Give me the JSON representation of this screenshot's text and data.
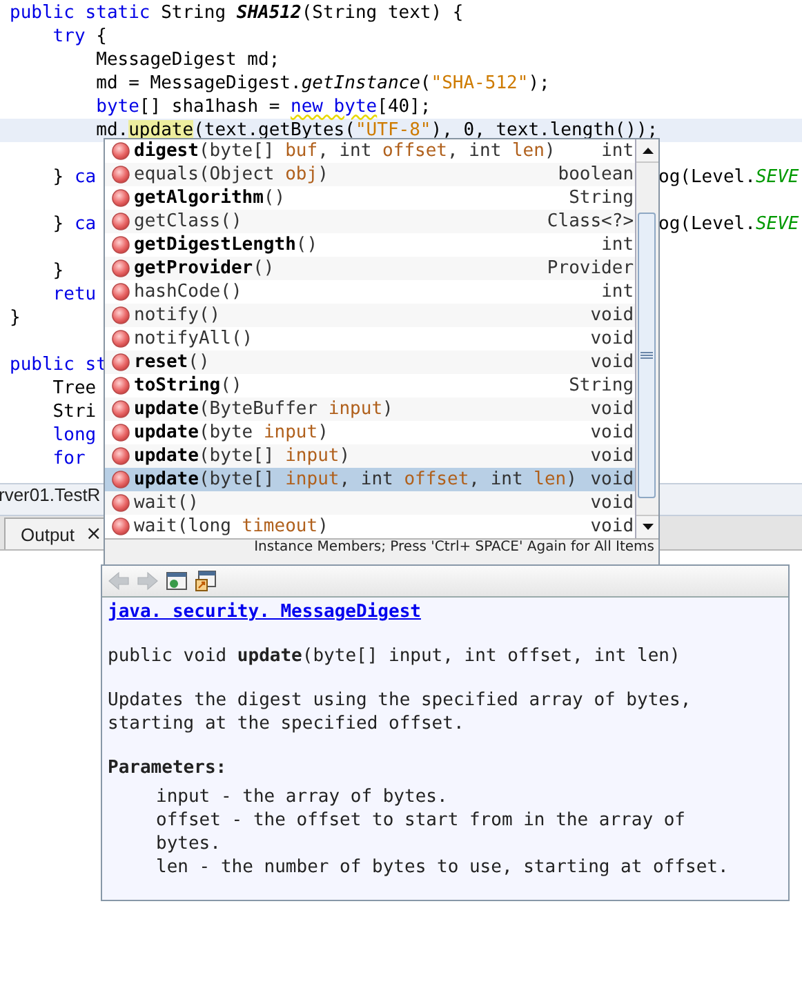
{
  "editor": {
    "lines": [
      {
        "current": false,
        "segments": [
          {
            "text": "public static ",
            "kind": "keyword"
          },
          {
            "text": "String ",
            "kind": "plain"
          },
          {
            "text": "SHA512",
            "kind": "method-bold-italic"
          },
          {
            "text": "(String text) {",
            "kind": "plain"
          }
        ]
      },
      {
        "current": false,
        "segments": [
          {
            "text": "    try",
            "kind": "keyword"
          },
          {
            "text": " {",
            "kind": "plain"
          }
        ]
      },
      {
        "current": false,
        "segments": [
          {
            "text": "        MessageDigest md;",
            "kind": "plain"
          }
        ]
      },
      {
        "current": false,
        "segments": [
          {
            "text": "        md = MessageDigest.",
            "kind": "plain"
          },
          {
            "text": "getInstance",
            "kind": "method-italic"
          },
          {
            "text": "(",
            "kind": "plain"
          },
          {
            "text": "\"SHA-512\"",
            "kind": "string"
          },
          {
            "text": ");",
            "kind": "plain"
          }
        ]
      },
      {
        "current": false,
        "segments": [
          {
            "text": "        byte",
            "kind": "keyword"
          },
          {
            "text": "[] sha1hash = ",
            "kind": "plain"
          },
          {
            "text": "new byte",
            "kind": "keyword-warning"
          },
          {
            "text": "[40];",
            "kind": "plain"
          }
        ]
      },
      {
        "current": true,
        "segments": [
          {
            "text": "        md.",
            "kind": "plain"
          },
          {
            "text": "update",
            "kind": "occurrence"
          },
          {
            "text": "(text.getBytes(",
            "kind": "plain"
          },
          {
            "text": "\"UTF-8\"",
            "kind": "string"
          },
          {
            "text": "), 0, text.length());",
            "kind": "plain"
          }
        ]
      },
      {
        "current": false
      },
      {
        "current": false,
        "segments": [
          {
            "text": "    } ",
            "kind": "plain"
          },
          {
            "text": "ca",
            "kind": "keyword"
          }
        ],
        "right": [
          {
            "text": "og(Level.",
            "kind": "plain"
          },
          {
            "text": "SEVE",
            "kind": "constant"
          }
        ]
      },
      {
        "current": false
      },
      {
        "current": false,
        "segments": [
          {
            "text": "    } ",
            "kind": "plain"
          },
          {
            "text": "ca",
            "kind": "keyword"
          }
        ],
        "right": [
          {
            "text": "og(Level.",
            "kind": "plain"
          },
          {
            "text": "SEVE",
            "kind": "constant"
          }
        ]
      },
      {
        "current": false
      },
      {
        "current": false,
        "segments": [
          {
            "text": "    }",
            "kind": "plain"
          }
        ]
      },
      {
        "current": false,
        "segments": [
          {
            "text": "    retu",
            "kind": "keyword"
          }
        ]
      },
      {
        "current": false,
        "segments": [
          {
            "text": "}",
            "kind": "plain"
          }
        ]
      },
      {
        "current": false
      },
      {
        "current": false,
        "segments": [
          {
            "text": "public st",
            "kind": "keyword"
          }
        ]
      },
      {
        "current": false,
        "segments": [
          {
            "text": "    Tree",
            "kind": "plain"
          }
        ]
      },
      {
        "current": false,
        "segments": [
          {
            "text": "    Stri",
            "kind": "plain"
          }
        ]
      },
      {
        "current": false,
        "segments": [
          {
            "text": "    long",
            "kind": "keyword"
          }
        ]
      },
      {
        "current": false,
        "segments": [
          {
            "text": "    for",
            "kind": "keyword"
          }
        ]
      }
    ]
  },
  "breadcrumb": "rver01.TestR",
  "output_tab": {
    "label": "Output",
    "close": "×"
  },
  "completion": {
    "items": [
      {
        "selected": false,
        "type": "int",
        "segments": [
          {
            "text": "digest",
            "kind": "name-bold"
          },
          {
            "text": "(byte[] ",
            "kind": "plain"
          },
          {
            "text": "buf",
            "kind": "param"
          },
          {
            "text": ", int ",
            "kind": "plain"
          },
          {
            "text": "offset",
            "kind": "param"
          },
          {
            "text": ", int ",
            "kind": "plain"
          },
          {
            "text": "len",
            "kind": "param"
          },
          {
            "text": ")",
            "kind": "plain"
          }
        ]
      },
      {
        "selected": false,
        "type": "boolean",
        "segments": [
          {
            "text": "equals",
            "kind": "name"
          },
          {
            "text": "(Object ",
            "kind": "plain"
          },
          {
            "text": "obj",
            "kind": "param"
          },
          {
            "text": ")",
            "kind": "plain"
          }
        ]
      },
      {
        "selected": false,
        "type": "String",
        "segments": [
          {
            "text": "getAlgorithm",
            "kind": "name-bold"
          },
          {
            "text": "()",
            "kind": "plain"
          }
        ]
      },
      {
        "selected": false,
        "type": "Class<?>",
        "segments": [
          {
            "text": "getClass",
            "kind": "name"
          },
          {
            "text": "()",
            "kind": "plain"
          }
        ]
      },
      {
        "selected": false,
        "type": "int",
        "segments": [
          {
            "text": "getDigestLength",
            "kind": "name-bold"
          },
          {
            "text": "()",
            "kind": "plain"
          }
        ]
      },
      {
        "selected": false,
        "type": "Provider",
        "segments": [
          {
            "text": "getProvider",
            "kind": "name-bold"
          },
          {
            "text": "()",
            "kind": "plain"
          }
        ]
      },
      {
        "selected": false,
        "type": "int",
        "segments": [
          {
            "text": "hashCode",
            "kind": "name"
          },
          {
            "text": "()",
            "kind": "plain"
          }
        ]
      },
      {
        "selected": false,
        "type": "void",
        "segments": [
          {
            "text": "notify",
            "kind": "name"
          },
          {
            "text": "()",
            "kind": "plain"
          }
        ]
      },
      {
        "selected": false,
        "type": "void",
        "segments": [
          {
            "text": "notifyAll",
            "kind": "name"
          },
          {
            "text": "()",
            "kind": "plain"
          }
        ]
      },
      {
        "selected": false,
        "type": "void",
        "segments": [
          {
            "text": "reset",
            "kind": "name-bold"
          },
          {
            "text": "()",
            "kind": "plain"
          }
        ]
      },
      {
        "selected": false,
        "type": "String",
        "segments": [
          {
            "text": "toString",
            "kind": "name-bold"
          },
          {
            "text": "()",
            "kind": "plain"
          }
        ]
      },
      {
        "selected": false,
        "type": "void",
        "segments": [
          {
            "text": "update",
            "kind": "name-bold"
          },
          {
            "text": "(ByteBuffer ",
            "kind": "plain"
          },
          {
            "text": "input",
            "kind": "param"
          },
          {
            "text": ")",
            "kind": "plain"
          }
        ]
      },
      {
        "selected": false,
        "type": "void",
        "segments": [
          {
            "text": "update",
            "kind": "name-bold"
          },
          {
            "text": "(byte ",
            "kind": "plain"
          },
          {
            "text": "input",
            "kind": "param"
          },
          {
            "text": ")",
            "kind": "plain"
          }
        ]
      },
      {
        "selected": false,
        "type": "void",
        "segments": [
          {
            "text": "update",
            "kind": "name-bold"
          },
          {
            "text": "(byte[] ",
            "kind": "plain"
          },
          {
            "text": "input",
            "kind": "param"
          },
          {
            "text": ")",
            "kind": "plain"
          }
        ]
      },
      {
        "selected": true,
        "type": "void",
        "segments": [
          {
            "text": "update",
            "kind": "name-bold"
          },
          {
            "text": "(byte[] ",
            "kind": "plain"
          },
          {
            "text": "input",
            "kind": "param"
          },
          {
            "text": ", int ",
            "kind": "plain"
          },
          {
            "text": "offset",
            "kind": "param"
          },
          {
            "text": ", int ",
            "kind": "plain"
          },
          {
            "text": "len",
            "kind": "param"
          },
          {
            "text": ")",
            "kind": "plain"
          }
        ]
      },
      {
        "selected": false,
        "type": "void",
        "segments": [
          {
            "text": "wait",
            "kind": "name"
          },
          {
            "text": "()",
            "kind": "plain"
          }
        ]
      },
      {
        "selected": false,
        "type": "void",
        "segments": [
          {
            "text": "wait",
            "kind": "name"
          },
          {
            "text": "(long ",
            "kind": "plain"
          },
          {
            "text": "timeout",
            "kind": "param"
          },
          {
            "text": ")",
            "kind": "plain"
          }
        ]
      }
    ],
    "footer": "Instance Members; Press 'Ctrl+ SPACE' Again for All Items"
  },
  "documentation": {
    "toolbar": [
      {
        "kind": "back",
        "disabled": true
      },
      {
        "kind": "forward",
        "disabled": true
      },
      {
        "kind": "browser",
        "disabled": false
      },
      {
        "kind": "source",
        "disabled": false
      }
    ],
    "link": "java. security. MessageDigest",
    "signature": "public void **update**(byte[] input, int offset, int len)",
    "description": "Updates the digest using the specified array of bytes, starting at the specified offset.",
    "parameters_heading": "Parameters:",
    "parameters": [
      "input - the array of bytes.",
      "offset - the offset to start from in the array of bytes.",
      "len - the number of bytes to use, starting at offset."
    ]
  }
}
